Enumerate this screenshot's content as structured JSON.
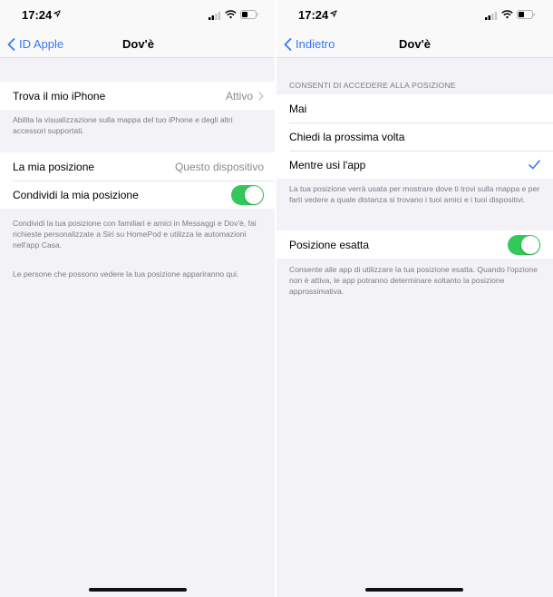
{
  "status_bar": {
    "time": "17:24",
    "icons": [
      "location-arrow-icon",
      "cellular-signal-icon",
      "wifi-icon",
      "battery-icon"
    ]
  },
  "left_screen": {
    "nav": {
      "back_label": "ID Apple",
      "title": "Dov'è"
    },
    "find_my": {
      "label": "Trova il mio iPhone",
      "value": "Attivo"
    },
    "find_my_note": "Abilita la visualizzazione sulla mappa del tuo iPhone e degli altri accessori supportati.",
    "my_location": {
      "label": "La mia posizione",
      "value": "Questo dispositivo"
    },
    "share_location": {
      "label": "Condividi la mia posizione",
      "enabled": true
    },
    "share_note": "Condividi la tua posizione con familiari e amici in Messaggi e Dov'è, fai richieste personalizzate a Siri su HomePod e utilizza le automazioni nell'app Casa.",
    "people_note": "Le persone che possono vedere la tua posizione appariranno qui."
  },
  "right_screen": {
    "nav": {
      "back_label": "Indietro",
      "title": "Dov'è"
    },
    "section_header": "CONSENTI DI ACCEDERE ALLA POSIZIONE",
    "options": [
      {
        "label": "Mai",
        "selected": false
      },
      {
        "label": "Chiedi la prossima volta",
        "selected": false
      },
      {
        "label": "Mentre usi l'app",
        "selected": true
      }
    ],
    "options_note": "La tua posizione verrà usata per mostrare dove ti trovi sulla mappa e per farti vedere a quale distanza si trovano i tuoi amici e i tuoi dispositivi.",
    "precise": {
      "label": "Posizione esatta",
      "enabled": true
    },
    "precise_note": "Consente alle app di utilizzare la tua posizione esatta. Quando l'opzione non è attiva, le app potranno determinare soltanto la posizione approssimativa."
  },
  "colors": {
    "accent": "#3478f6",
    "toggle_on": "#34c759",
    "background": "#f2f2f7"
  }
}
